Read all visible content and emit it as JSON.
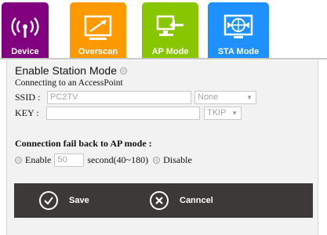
{
  "tabs": [
    {
      "label": "Device",
      "icon": "wireless-signal-icon",
      "color": "#800080"
    },
    {
      "label": "Overscan",
      "icon": "monitor-resize-icon",
      "color": "#ff9900"
    },
    {
      "label": "AP Mode",
      "icon": "monitor-arrow-icon",
      "color": "#88c700"
    },
    {
      "label": "STA Mode",
      "icon": "globe-arrows-icon",
      "color": "#1e90ff"
    }
  ],
  "section": {
    "title": "Enable Station Mode",
    "subtitle": "Connecting to an AccessPoint"
  },
  "ssid": {
    "label": "SSID :",
    "value": "PC2TV",
    "security": "None"
  },
  "key": {
    "label": "KEY :",
    "value": "",
    "encryption": "TKIP"
  },
  "fallback": {
    "title": "Connection fail back to AP mode :",
    "enable_label": "Enable",
    "seconds_value": "50",
    "seconds_suffix": "second(40~180)",
    "disable_label": "Disable"
  },
  "actions": {
    "save_label": "Save",
    "cancel_label": "Canncel"
  }
}
